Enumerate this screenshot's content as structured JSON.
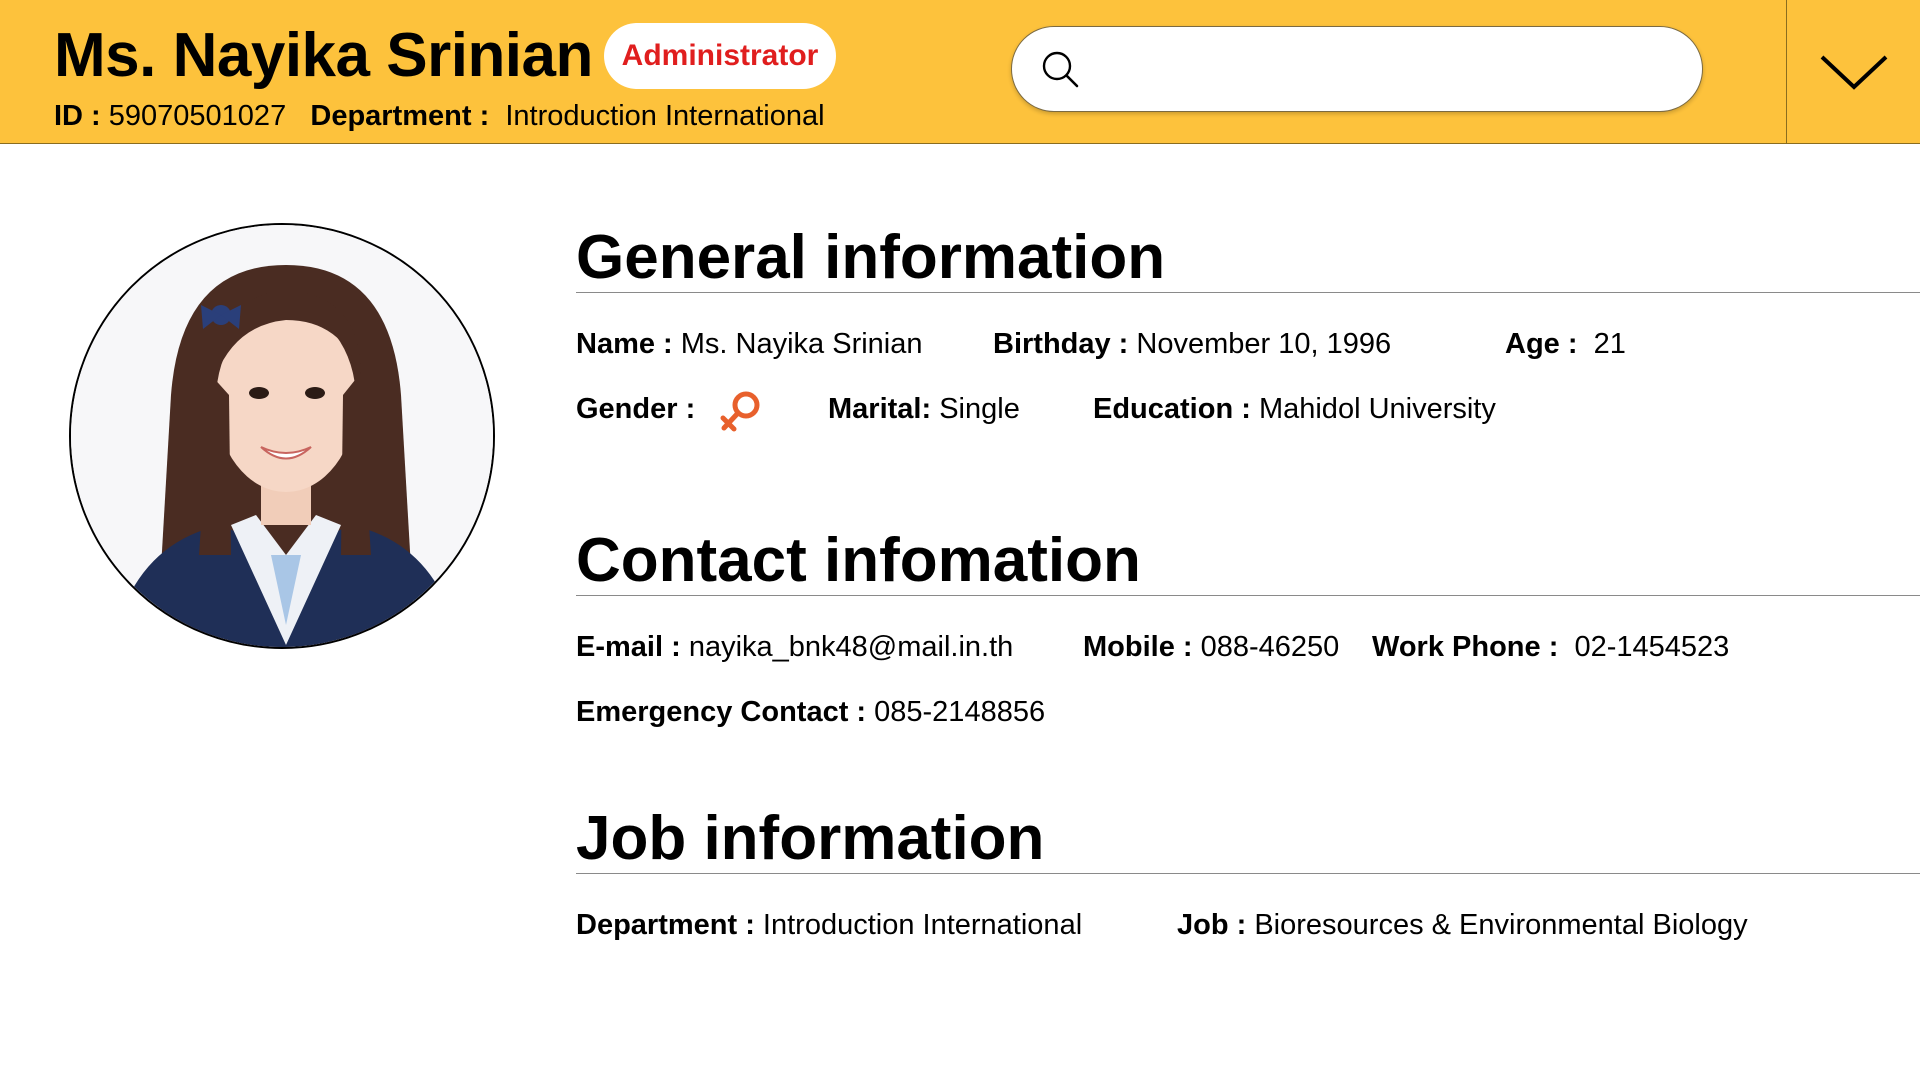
{
  "header": {
    "name": "Ms. Nayika Srinian",
    "role": "Administrator",
    "id_label": "ID :",
    "id_value": "59070501027",
    "department_label": "Department :",
    "department_value": "Introduction International",
    "search_placeholder": "",
    "colors": {
      "header_bg": "#fdc23c",
      "role_text": "#e01e1e"
    }
  },
  "general": {
    "title": "General information",
    "name_label": "Name :",
    "name_value": "Ms. Nayika Srinian",
    "birthday_label": "Birthday :",
    "birthday_value": "November 10, 1996",
    "age_label": "Age :",
    "age_value": "21",
    "gender_label": "Gender :",
    "gender_icon": "female-symbol-icon",
    "marital_label": "Marital:",
    "marital_value": "Single",
    "education_label": "Education :",
    "education_value": "Mahidol University"
  },
  "contact": {
    "title": "Contact infomation",
    "email_label": "E-mail :",
    "email_value": "nayika_bnk48@mail.in.th",
    "mobile_label": "Mobile :",
    "mobile_value": "088-46250",
    "work_phone_label": "Work Phone :",
    "work_phone_value": "02-1454523",
    "emergency_label": "Emergency Contact :",
    "emergency_value": "085-2148856"
  },
  "job": {
    "title": "Job information",
    "department_label": "Department :",
    "department_value": "Introduction International",
    "job_label": "Job :",
    "job_value": "Bioresources & Environmental Biology"
  },
  "icons": {
    "search": "search-icon",
    "menu": "chevron-down-icon",
    "gender": "female-symbol-icon"
  }
}
